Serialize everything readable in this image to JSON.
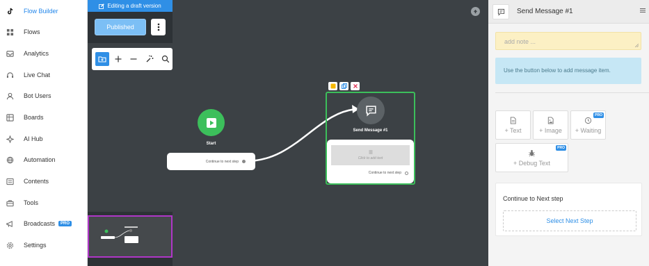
{
  "sidebar": {
    "items": [
      {
        "label": "Flow Builder",
        "icon": "tiktok-icon",
        "active": true
      },
      {
        "label": "Flows",
        "icon": "grid-icon"
      },
      {
        "label": "Analytics",
        "icon": "inbox-icon"
      },
      {
        "label": "Live Chat",
        "icon": "headset-icon"
      },
      {
        "label": "Bot Users",
        "icon": "user-icon"
      },
      {
        "label": "Boards",
        "icon": "board-icon"
      },
      {
        "label": "AI Hub",
        "icon": "ai-hub-icon"
      },
      {
        "label": "Automation",
        "icon": "globe-icon"
      },
      {
        "label": "Contents",
        "icon": "contents-icon"
      },
      {
        "label": "Tools",
        "icon": "toolbox-icon"
      },
      {
        "label": "Broadcasts",
        "icon": "megaphone-icon",
        "badge": "PRO"
      },
      {
        "label": "Settings",
        "icon": "gear-icon"
      }
    ]
  },
  "canvas": {
    "draft_banner": "Editing a draft version",
    "published_label": "Published",
    "toolbar_icons": [
      "add-folder-icon",
      "plus-icon",
      "minus-icon",
      "magic-wand-icon",
      "search-icon"
    ],
    "start_label": "Start",
    "start_continue": "Continue to next step",
    "message_node": {
      "title": "Send Message #1",
      "text_placeholder": "Click to add text",
      "continue": "Continue to next step"
    }
  },
  "panel": {
    "title": "Send Message #1",
    "note_placeholder": "add note ...",
    "info_text": "Use the button below to add message item.",
    "add_buttons": [
      {
        "label": "+ Text",
        "icon": "document-icon"
      },
      {
        "label": "+ Image",
        "icon": "image-icon"
      },
      {
        "label": "+ Waiting",
        "icon": "clock-icon",
        "badge": "PRO"
      },
      {
        "label": "+ Debug Text",
        "icon": "bug-icon",
        "badge": "PRO"
      }
    ],
    "next_step_title": "Continue to Next step",
    "select_next_label": "Select Next Step"
  },
  "colors": {
    "accent": "#2f8fe6",
    "canvas_bg": "#3c4145",
    "start_green": "#3cbf5b",
    "minimap_border": "#b036c8",
    "note_bg": "#fcf0c4",
    "info_bg": "#c6e7f5"
  }
}
